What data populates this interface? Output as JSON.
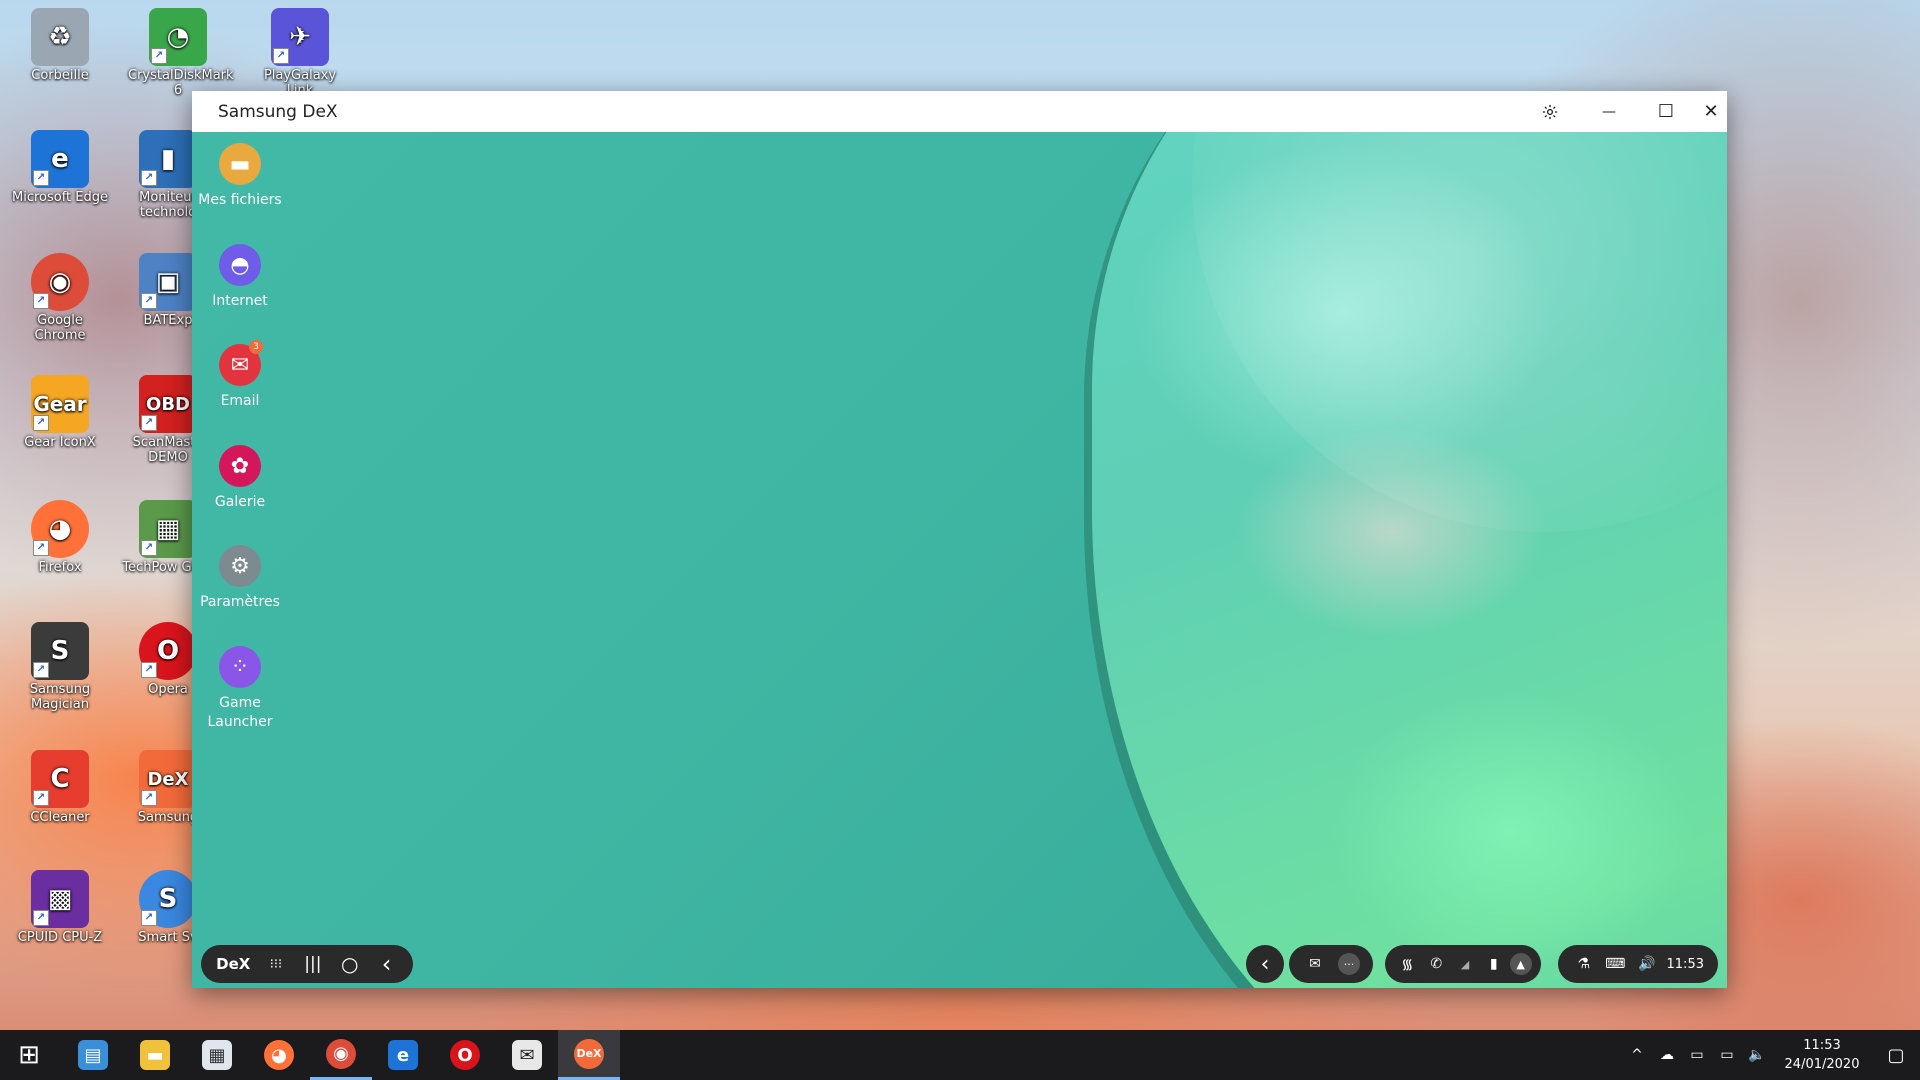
{
  "desktop": {
    "icons": [
      {
        "label": "Corbeille",
        "glyph": "♻",
        "color": "#9aa7b3"
      },
      {
        "label": "CrystalDiskMark 6",
        "glyph": "◔",
        "color": "#3aa64a"
      },
      {
        "label": "PlayGalaxy Link",
        "glyph": "✈",
        "color": "#5a55d8"
      },
      {
        "label": "Microsoft Edge",
        "glyph": "e",
        "color": "#1e73d6"
      },
      {
        "label": "Moniteur technolo",
        "glyph": "▮",
        "color": "#2d6fb8"
      },
      {
        "label": "Google Chrome",
        "glyph": "◉",
        "color": "#dd4b39"
      },
      {
        "label": "BATExp",
        "glyph": "▣",
        "color": "#4d82c5"
      },
      {
        "label": "Gear IconX",
        "glyph": "Gear",
        "color": "#f5a623"
      },
      {
        "label": "ScanMaste DEMO",
        "glyph": "OBD",
        "color": "#d32020"
      },
      {
        "label": "Firefox",
        "glyph": "◕",
        "color": "#ff7139"
      },
      {
        "label": "TechPow GPU-",
        "glyph": "▦",
        "color": "#5a9a4a"
      },
      {
        "label": "Samsung Magician",
        "glyph": "S",
        "color": "#3b3b3b"
      },
      {
        "label": "Opera",
        "glyph": "O",
        "color": "#d8141c"
      },
      {
        "label": "CCleaner",
        "glyph": "C",
        "color": "#e63d2e"
      },
      {
        "label": "Samsung",
        "glyph": "DeX",
        "color": "#f26a3a"
      },
      {
        "label": "CPUID CPU-Z",
        "glyph": "▩",
        "color": "#6a2ea0"
      },
      {
        "label": "Smart Sv",
        "glyph": "S",
        "color": "#3a88e0"
      }
    ]
  },
  "window": {
    "title": "Samsung DeX",
    "settings_icon": "gear-icon",
    "minimize_glyph": "—",
    "maximize_glyph": "☐",
    "close_glyph": "✕"
  },
  "dex": {
    "apps": [
      {
        "label": "Mes fichiers",
        "glyph": "▬",
        "color": "#e9a93f"
      },
      {
        "label": "Internet",
        "glyph": "◓",
        "color": "#6f5ce8"
      },
      {
        "label": "Email",
        "glyph": "✉",
        "color": "#e2343f",
        "badge": "3"
      },
      {
        "label": "Galerie",
        "glyph": "✿",
        "color": "#d4165a"
      },
      {
        "label": "Paramètres",
        "glyph": "⚙",
        "color": "#7d8a90"
      },
      {
        "label": "Game Launcher",
        "glyph": "⁘",
        "color": "#8a56e8"
      }
    ],
    "taskbar": {
      "dex_label": "DeX",
      "apps_glyph": "⁝⁝⁝",
      "recents_glyph": "|||",
      "home_glyph": "○",
      "back_glyph": "‹",
      "scroll_back_glyph": "‹",
      "email_glyph": "✉",
      "more_glyph": "···",
      "wifi_glyph": "᯾",
      "call_glyph": "✆",
      "signal_glyph": "◢",
      "battery_glyph": "▮",
      "expand_glyph": "▲",
      "lab_glyph": "⚗",
      "keyboard_glyph": "⌨",
      "volume_glyph": "🔊",
      "time": "11:53"
    }
  },
  "taskbar": {
    "start_glyph": "⊞",
    "items": [
      {
        "name": "file-explorer-pinned",
        "glyph": "▤",
        "color": "#3b8fd9"
      },
      {
        "name": "file-explorer",
        "glyph": "▬",
        "color": "#f0c23b"
      },
      {
        "name": "microsoft-store",
        "glyph": "▦",
        "color": "#dfe6ee"
      },
      {
        "name": "firefox",
        "glyph": "◕",
        "color": "#ff7139"
      },
      {
        "name": "chrome",
        "glyph": "◉",
        "color": "#dd4b39"
      },
      {
        "name": "edge",
        "glyph": "e",
        "color": "#1e73d6"
      },
      {
        "name": "opera",
        "glyph": "O",
        "color": "#d8141c"
      },
      {
        "name": "mail",
        "glyph": "✉",
        "color": "#e8e8e8"
      },
      {
        "name": "samsung-dex",
        "glyph": "DeX",
        "color": "#f26a3a"
      }
    ],
    "tray": {
      "chevron_glyph": "^",
      "cloud_glyph": "☁",
      "battery_glyph": "▭",
      "network_glyph": "▭",
      "volume_glyph": "🔈",
      "time": "11:53",
      "date": "24/01/2020",
      "notification_glyph": "▢"
    }
  }
}
